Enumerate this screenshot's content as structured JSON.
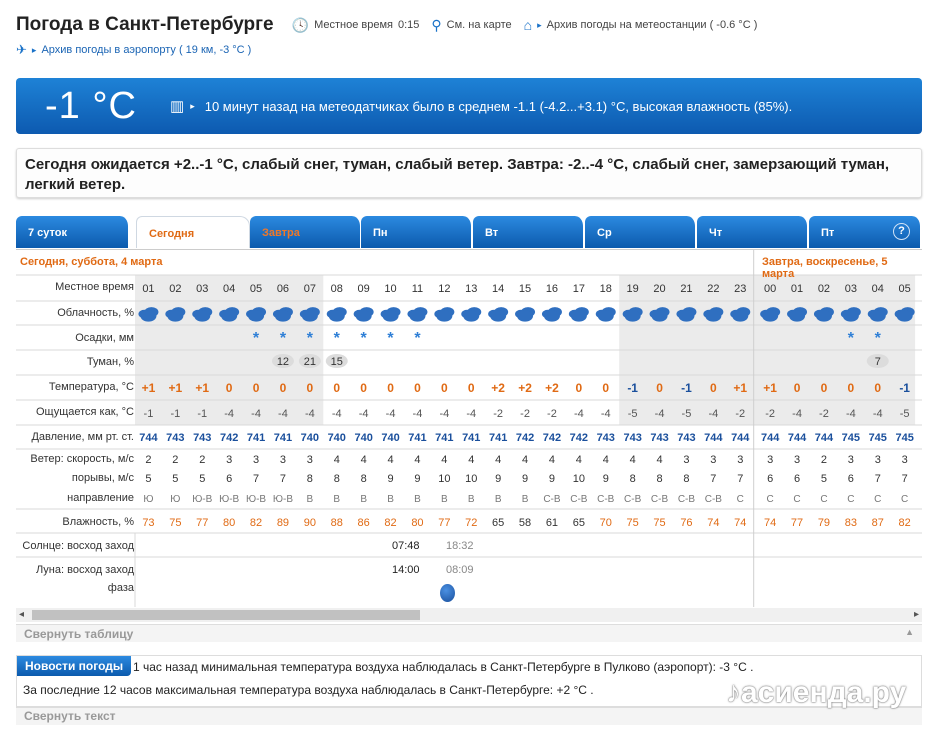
{
  "header": {
    "title": "Погода в Санкт-Петербурге",
    "local_time_label": "Местное время",
    "local_time": "0:15",
    "map_link": "См. на карте",
    "archive_station": "Архив погоды на метеостанции ( -0.6 °C )",
    "archive_airport": "Архив погоды в аэропорту ( 19 км, -3 °C )"
  },
  "now": {
    "temp": "-1 °C",
    "desc": "10 минут назад на метеодатчиках было в среднем -1.1 (-4.2...+3.1) °C, высокая влажность (85%)."
  },
  "forecast": "Сегодня ожидается +2..-1 °C, слабый снег, туман, слабый ветер. Завтра: -2..-4 °C, слабый снег, замерзающий туман, легкий ветер.",
  "tabs": [
    "7 суток",
    "Сегодня",
    "Завтра",
    "Пн",
    "Вт",
    "Ср",
    "Чт",
    "Пт"
  ],
  "help": "?",
  "day1": "Сегодня, суббота, 4 марта",
  "day2": "Завтра, воскресенье, 5 марта",
  "labels": {
    "time": "Местное время",
    "cloud": "Облачность, %",
    "precip": "Осадки, мм",
    "fog": "Туман, %",
    "temp": "Температура, °C",
    "feel": "Ощущается как, °C",
    "press": "Давление, мм рт. ст.",
    "wind": "Ветер: скорость, м/с",
    "gust": "порывы, м/с",
    "dir": "направление",
    "hum": "Влажность, %",
    "sun": "Солнце: восход заход",
    "moon": "Луна: восход заход",
    "phase": "фаза"
  },
  "sun": {
    "rise": "07:48",
    "set": "18:32"
  },
  "moon": {
    "rise": "14:00",
    "set": "08:09"
  },
  "hours": [
    "01",
    "02",
    "03",
    "04",
    "05",
    "06",
    "07",
    "08",
    "09",
    "10",
    "11",
    "12",
    "13",
    "14",
    "15",
    "16",
    "17",
    "18",
    "19",
    "20",
    "21",
    "22",
    "23",
    "00",
    "01",
    "02",
    "03",
    "04",
    "05"
  ],
  "snow": [
    0,
    0,
    0,
    0,
    1,
    1,
    1,
    1,
    1,
    1,
    1,
    0,
    0,
    0,
    0,
    0,
    0,
    0,
    0,
    0,
    0,
    0,
    0,
    0,
    0,
    0,
    1,
    1,
    0
  ],
  "fog": [
    "",
    "",
    "",
    "",
    "",
    "12",
    "21",
    "15",
    "",
    "",
    "",
    "",
    "",
    "",
    "",
    "",
    "",
    "",
    "",
    "",
    "",
    "",
    "",
    "",
    "",
    "",
    "",
    "7",
    ""
  ],
  "temp": [
    "+1",
    "+1",
    "+1",
    "0",
    "0",
    "0",
    "0",
    "0",
    "0",
    "0",
    "0",
    "0",
    "0",
    "+2",
    "+2",
    "+2",
    "0",
    "0",
    "-1",
    "0",
    "-1",
    "0",
    "+1",
    "+1",
    "0",
    "0",
    "0",
    "0",
    "-1"
  ],
  "feel": [
    "-1",
    "-1",
    "-1",
    "-4",
    "-4",
    "-4",
    "-4",
    "-4",
    "-4",
    "-4",
    "-4",
    "-4",
    "-4",
    "-2",
    "-2",
    "-2",
    "-4",
    "-4",
    "-5",
    "-4",
    "-5",
    "-4",
    "-2",
    "-2",
    "-4",
    "-2",
    "-4",
    "-4",
    "-5"
  ],
  "press": [
    "744",
    "743",
    "743",
    "742",
    "741",
    "741",
    "740",
    "740",
    "740",
    "740",
    "741",
    "741",
    "741",
    "741",
    "742",
    "742",
    "742",
    "743",
    "743",
    "743",
    "743",
    "744",
    "744",
    "744",
    "744",
    "744",
    "745",
    "745",
    "745"
  ],
  "wind": [
    "2",
    "2",
    "2",
    "3",
    "3",
    "3",
    "3",
    "4",
    "4",
    "4",
    "4",
    "4",
    "4",
    "4",
    "4",
    "4",
    "4",
    "4",
    "4",
    "4",
    "3",
    "3",
    "3",
    "3",
    "3",
    "2",
    "3",
    "3",
    "3"
  ],
  "gust": [
    "5",
    "5",
    "5",
    "6",
    "7",
    "7",
    "8",
    "8",
    "8",
    "9",
    "9",
    "10",
    "10",
    "9",
    "9",
    "9",
    "10",
    "9",
    "8",
    "8",
    "8",
    "7",
    "7",
    "6",
    "6",
    "5",
    "6",
    "7",
    "7"
  ],
  "dir": [
    "Ю",
    "Ю",
    "Ю-В",
    "Ю-В",
    "Ю-В",
    "Ю-В",
    "В",
    "В",
    "В",
    "В",
    "В",
    "В",
    "В",
    "В",
    "В",
    "С-В",
    "С-В",
    "С-В",
    "С-В",
    "С-В",
    "С-В",
    "С-В",
    "С",
    "С",
    "С",
    "С",
    "С",
    "С",
    "С"
  ],
  "hum": [
    "73",
    "75",
    "77",
    "80",
    "82",
    "89",
    "90",
    "88",
    "86",
    "82",
    "80",
    "77",
    "72",
    "65",
    "58",
    "61",
    "65",
    "70",
    "75",
    "75",
    "76",
    "74",
    "74",
    "74",
    "77",
    "79",
    "83",
    "87",
    "82"
  ],
  "collapse_table": "Свернуть таблицу",
  "news": {
    "title": "Новости погоды",
    "line1": "1 час назад минимальная температура воздуха наблюдалась в Санкт-Петербурге в Пулково (аэропорт): -3 °C .",
    "line2": "За последние 12 часов максимальная температура воздуха наблюдалась в Санкт-Петербурге: +2 °C ."
  },
  "collapse_text": "Свернуть текст",
  "watermark": "асиенда.ру",
  "colors": {
    "accent": "#1a72c8",
    "warm": "#e06a14",
    "cold": "#1a4f9c"
  }
}
